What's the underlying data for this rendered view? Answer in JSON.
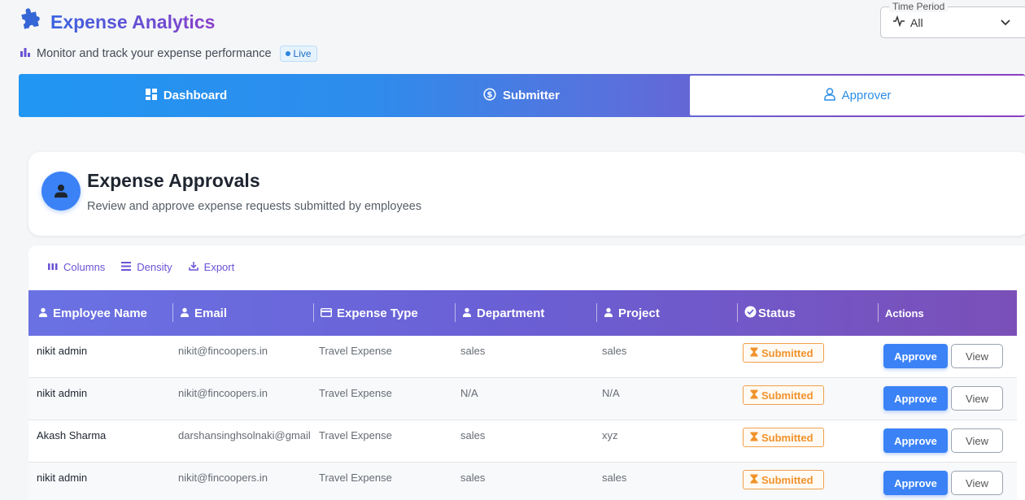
{
  "header": {
    "title": "Expense Analytics",
    "subtitle": "Monitor and track your expense performance",
    "live_badge": "Live"
  },
  "time_period": {
    "label": "Time Period",
    "value": "All"
  },
  "tabs": [
    {
      "label": "Dashboard",
      "icon": "dashboard-icon"
    },
    {
      "label": "Submitter",
      "icon": "dollar-circle-icon"
    },
    {
      "label": "Approver",
      "icon": "person-icon",
      "active": true
    }
  ],
  "card": {
    "title": "Expense Approvals",
    "subtitle": "Review and approve expense requests submitted by employees"
  },
  "toolbar": {
    "columns": "Columns",
    "density": "Density",
    "export": "Export"
  },
  "table": {
    "columns": [
      "Employee Name",
      "Email",
      "Expense Type",
      "Department",
      "Project",
      "Status",
      "Actions"
    ],
    "rows": [
      {
        "name": "nikit admin",
        "email": "nikit@fincoopers.in",
        "type": "Travel Expense",
        "department": "sales",
        "project": "sales",
        "status": "Submitted"
      },
      {
        "name": "nikit admin",
        "email": "nikit@fincoopers.in",
        "type": "Travel Expense",
        "department": "N/A",
        "project": "N/A",
        "status": "Submitted"
      },
      {
        "name": "Akash Sharma",
        "email": "darshansinghsolnaki@gmail.com",
        "type": "Travel Expense",
        "department": "sales",
        "project": "xyz",
        "status": "Submitted"
      },
      {
        "name": "nikit admin",
        "email": "nikit@fincoopers.in",
        "type": "Travel Expense",
        "department": "sales",
        "project": "sales",
        "status": "Submitted"
      }
    ],
    "approve_label": "Approve",
    "view_label": "View"
  }
}
